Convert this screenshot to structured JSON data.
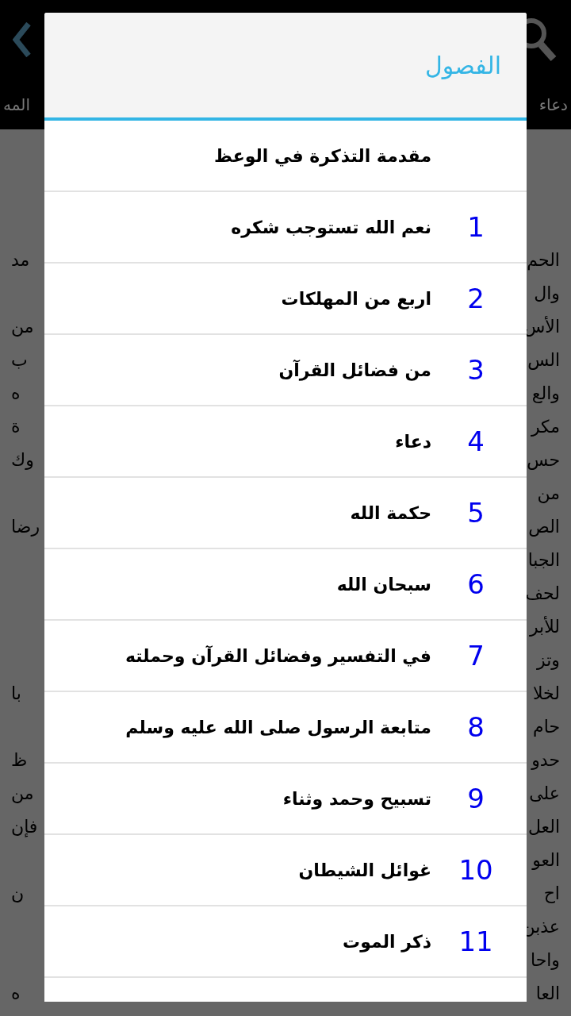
{
  "action_bar": {
    "tabs": [
      {
        "label": "دعاء",
        "selected": false
      },
      {
        "label": "المه",
        "selected": false
      }
    ]
  },
  "background_text": {
    "lines": [
      {
        "right": "الحم",
        "left": "مد"
      },
      {
        "right": "وال"
      },
      {
        "right": "الأس",
        "left": "من"
      },
      {
        "right": "الس",
        "left": "ب"
      },
      {
        "right": "والع",
        "left": "ه"
      },
      {
        "right": "مكر",
        "left": "ة"
      },
      {
        "right": "حس",
        "left": "وك"
      },
      {
        "right": "من"
      },
      {
        "right": "الص",
        "left": "رضا"
      },
      {
        "right": "الجبا"
      },
      {
        "right": "لحف"
      },
      {
        "right": "للأبر"
      },
      {
        "right": "وتز"
      },
      {
        "right": "لخلا",
        "left": "با"
      },
      {
        "right": "حام"
      },
      {
        "right": "حدو",
        "left": "ظ"
      },
      {
        "right": "على",
        "left": "من"
      },
      {
        "right": "العل",
        "left": "فإن"
      },
      {
        "right": "العو"
      },
      {
        "right": "اح",
        "left": "ن"
      },
      {
        "right": "عذبن"
      },
      {
        "right": "واحا"
      },
      {
        "right": "العا",
        "left": "ه"
      }
    ]
  },
  "dialog": {
    "title": "الفصول",
    "chapters": [
      {
        "title": "مقدمة التذكرة في الوعظ"
      },
      {
        "number": "1",
        "title": "نعم الله تستوجب شكره"
      },
      {
        "number": "2",
        "title": "اربع من المهلكات"
      },
      {
        "number": "3",
        "title": "من فضائل القرآن"
      },
      {
        "number": "4",
        "title": "دعاء"
      },
      {
        "number": "5",
        "title": "حكمة الله"
      },
      {
        "number": "6",
        "title": "سبحان الله"
      },
      {
        "number": "7",
        "title": "في التفسير وفضائل القرآن وحملته"
      },
      {
        "number": "8",
        "title": "متابعة الرسول صلى الله عليه وسلم"
      },
      {
        "number": "9",
        "title": "تسبيح وحمد وثناء"
      },
      {
        "number": "10",
        "title": "غوائل الشيطان"
      },
      {
        "number": "11",
        "title": "ذكر الموت"
      }
    ]
  }
}
